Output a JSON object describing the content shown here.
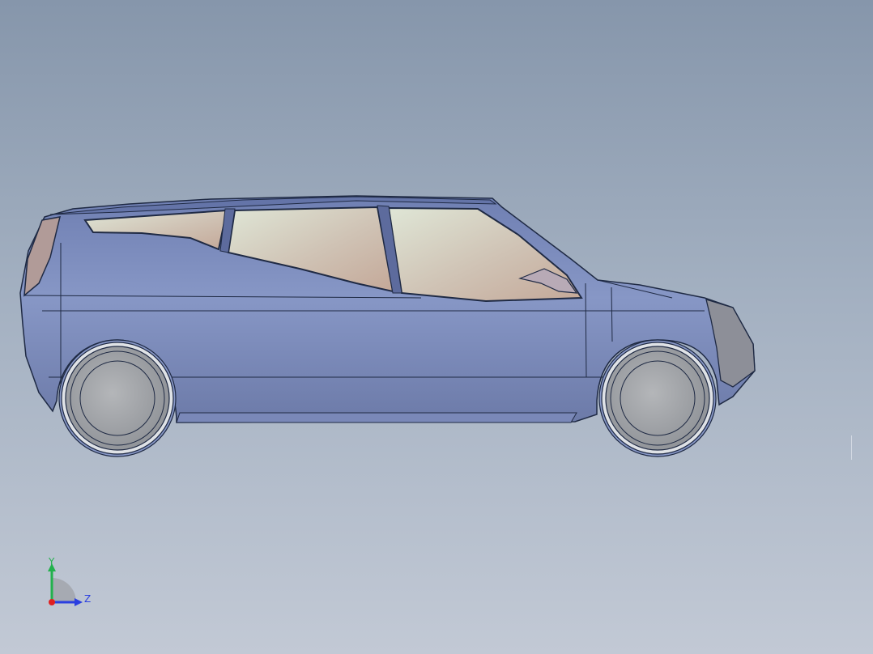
{
  "viewport": {
    "background_top": "#8696ab",
    "background_bottom": "#c2c9d5"
  },
  "model": {
    "view": "side-elevation",
    "body_color": "#7f93c2",
    "glass_color": "#d2c7bb",
    "wheel_color": "#a7a9ac",
    "edge_color": "#1f2a44"
  },
  "triad": {
    "y_label": "Y",
    "z_label": "Z",
    "y_color": "#22b14c",
    "z_color": "#2b3fe0",
    "x_color": "#e02020"
  }
}
